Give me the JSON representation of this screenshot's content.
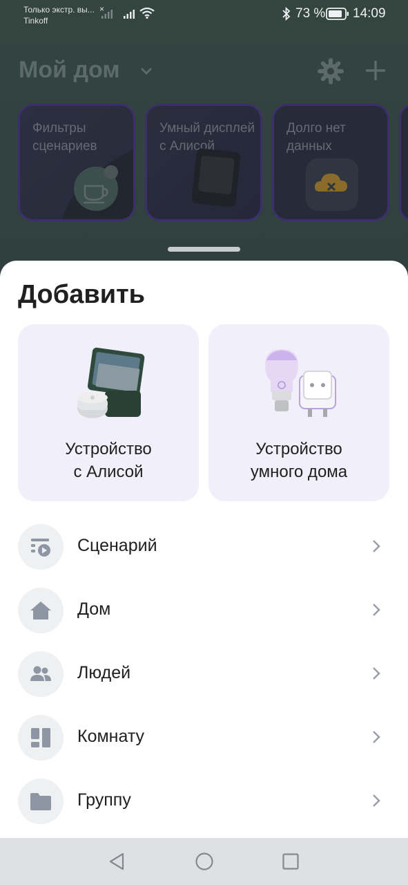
{
  "status_bar": {
    "notification_line1": "Только экстр. вы...",
    "notification_line2": "Tinkoff",
    "notification_x": "×",
    "battery_percent": "73 %",
    "time": "14:09",
    "icons": [
      "signal-icon",
      "wifi-icon",
      "bluetooth-icon",
      "battery-icon"
    ]
  },
  "background": {
    "home_title": "Мой дом",
    "cards": [
      {
        "label": "Фильтры сценариев",
        "icon": "cup-icon"
      },
      {
        "label": "Умный дисплей с Алисой",
        "icon": "smart-display-image"
      },
      {
        "label": "Долго нет данных",
        "icon": "cloud-offline-icon"
      }
    ]
  },
  "sheet": {
    "title": "Добавить",
    "tiles": [
      {
        "line1": "Устройство",
        "line2": "с Алисой",
        "icon": "alice-device-image"
      },
      {
        "line1": "Устройство",
        "line2": "умного дома",
        "icon": "smart-home-device-image"
      }
    ],
    "rows": [
      {
        "label": "Сценарий",
        "icon": "scenario-icon"
      },
      {
        "label": "Дом",
        "icon": "house-icon"
      },
      {
        "label": "Людей",
        "icon": "people-icon"
      },
      {
        "label": "Комнату",
        "icon": "room-icon"
      },
      {
        "label": "Группу",
        "icon": "folder-icon"
      }
    ]
  },
  "colors": {
    "accent_purple": "#3c2f6b",
    "tile_bg": "#f1f0fa",
    "icon_gray": "#8f96a3"
  }
}
